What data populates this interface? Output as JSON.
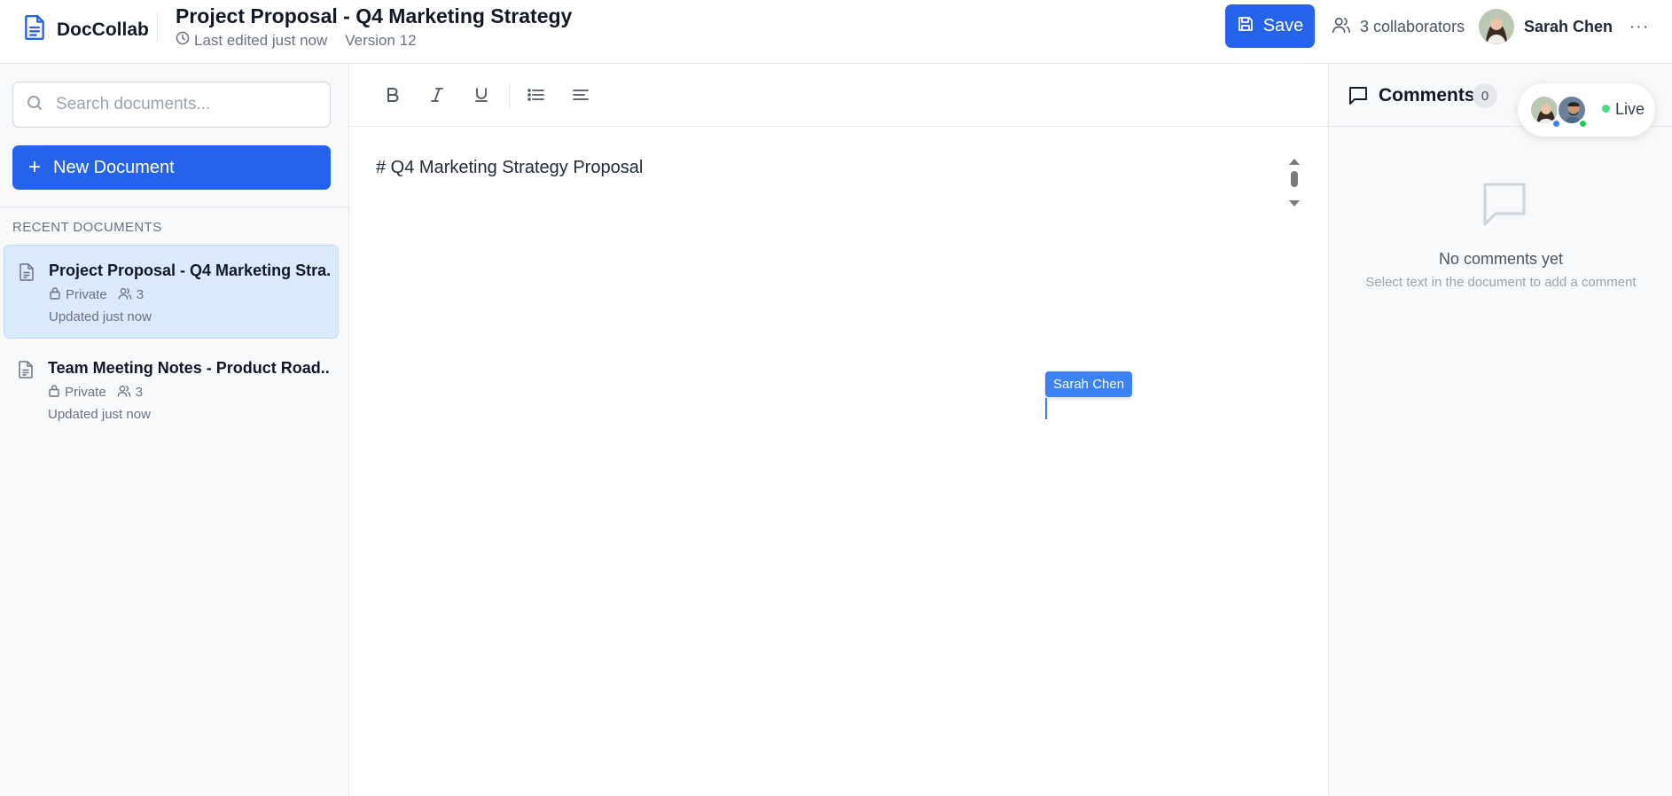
{
  "app": {
    "name": "DocCollab"
  },
  "document": {
    "title": "Project Proposal - Q4 Marketing Strategy",
    "last_edited": "Last edited just now",
    "version": "Version 12",
    "content_line": "# Q4 Marketing Strategy Proposal"
  },
  "header": {
    "save_label": "Save",
    "collaborators_label": "3 collaborators",
    "user_name": "Sarah Chen",
    "more_label": "···"
  },
  "sidebar": {
    "search_placeholder": "Search documents...",
    "new_document_label": "New Document",
    "section_label": "RECENT DOCUMENTS",
    "documents": [
      {
        "title": "Project Proposal - Q4 Marketing Stra...",
        "visibility": "Private",
        "collaborators": "3",
        "updated": "Updated just now",
        "active": true
      },
      {
        "title": "Team Meeting Notes - Product Road...",
        "visibility": "Private",
        "collaborators": "3",
        "updated": "Updated just now",
        "active": false
      }
    ]
  },
  "editor": {
    "remote_cursor_name": "Sarah Chen"
  },
  "comments": {
    "title": "Comments",
    "count": "0",
    "empty_title": "No comments yet",
    "empty_subtitle": "Select text in the document to add a comment"
  },
  "presence": {
    "live_label": "Live"
  },
  "colors": {
    "accent": "#2563eb",
    "active_item": "#dbeafe",
    "cursor": "#3b82f6",
    "live": "#4ade80"
  }
}
